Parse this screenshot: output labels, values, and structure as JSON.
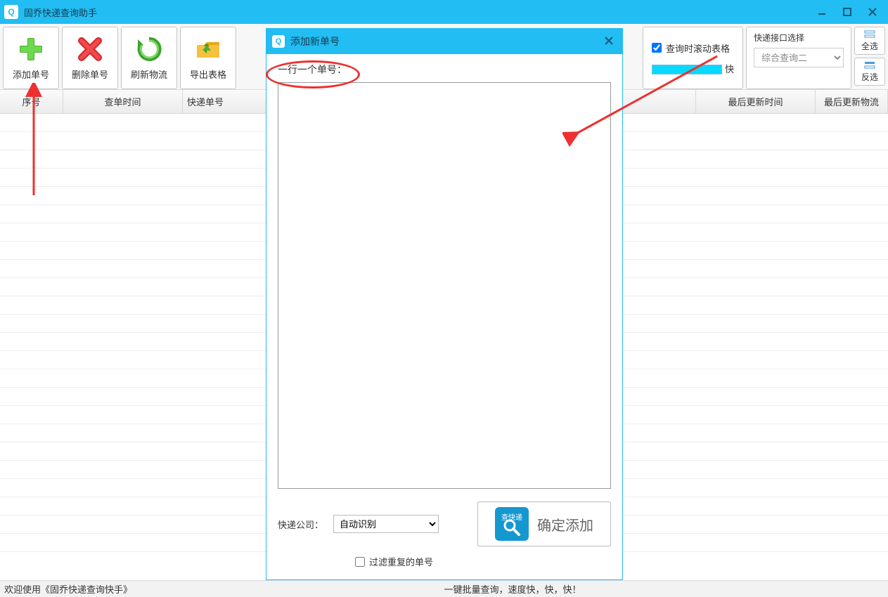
{
  "window": {
    "title": "固乔快递查询助手"
  },
  "toolbar": {
    "buttons": [
      {
        "label": "添加单号"
      },
      {
        "label": "删除单号"
      },
      {
        "label": "刷新物流"
      },
      {
        "label": "导出表格"
      }
    ],
    "checkbox_scroll": "查询时滚动表格",
    "progress_label": "快",
    "api_group": "快递接口选择",
    "api_selected": "综合查询二",
    "select_all": "全选",
    "invert_select": "反选"
  },
  "table": {
    "headers": [
      "序号",
      "查单时间",
      "快递单号",
      "最后更新时间",
      "最后更新物流"
    ]
  },
  "statusbar": {
    "left": "欢迎使用《固乔快递查询快手》",
    "right": "一键批量查询，速度快，快，快！"
  },
  "modal": {
    "title": "添加新单号",
    "hint": "一行一个单号：",
    "company_label": "快递公司：",
    "company_selected": "自动识别",
    "filter_dup": "过滤重复的单号",
    "confirm_label": "确定添加"
  }
}
